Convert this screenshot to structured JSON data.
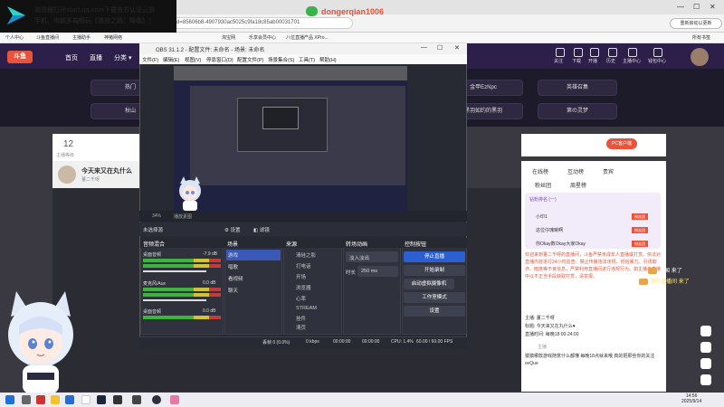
{
  "ad": {
    "line1": "浏览器打开start.qq.com下载官方认证云游",
    "line2": "手机、电脑多端畅玩《流放之路：降临》！"
  },
  "watermark": "dongerqian1006",
  "browser": {
    "url": "758&dyshid=85606b8-4907930ac5025c9fa18c85ab00031701",
    "update_label": "重新启动以更新",
    "bookmarks": [
      "个人中心",
      "斗鱼直播间",
      "主播助手",
      "神猪网络",
      "淘宝网",
      "乐享会员中心",
      "八位直播产品 XPro..."
    ],
    "all_bookmarks": "所有书签"
  },
  "site": {
    "logo": "斗鱼",
    "nav": [
      "首页",
      "直播",
      "分类 ▾"
    ],
    "nav_right": [
      "关注",
      "下载",
      "开播",
      "历史",
      "主播中心",
      "钱包中心"
    ],
    "categories_row1": [
      "热门",
      "",
      "",
      "",
      "金甲EzNpc",
      "英雄召集"
    ],
    "categories_row2": [
      "秋山",
      "",
      "",
      "",
      "黑羽如约的黑羽",
      "第の灵梦"
    ]
  },
  "room": {
    "stat_num": "12",
    "stat_label": "主播等级",
    "title": "今天来又在丸什么",
    "subtitle": "董二千呀"
  },
  "chat": {
    "pc_button": "PC客户端",
    "tabs": [
      "在线榜",
      "互动榜",
      "贵宾",
      "粉丝团",
      "周星榜"
    ],
    "rank_header": "钻粉排名 (一)",
    "ranks": [
      {
        "name": "小印1",
        "tag": "粉丝团"
      },
      {
        "name": "这位仔瑰喇啊",
        "tag": "粉丝团"
      },
      {
        "name": "你Okay数Okay大家Okay",
        "tag": "粉丝团"
      }
    ],
    "system_msg": "欢迎来到董二千呀的直播间，斗鱼严禁未成年人直播或打赏。依法对直播内容进行24小时巡查。禁止传播违法违规、低俗暴力、引诱欺诈、暗度等不良信息，严禁利用直播间进行违规行为。如主播在直播中以不正当手段获取打赏，请举报。",
    "lines": [
      {
        "user": "主播",
        "text": "董二千呀"
      },
      {
        "user": "标题",
        "text": "今天来又在丸什么♥"
      },
      {
        "user": "直播时间",
        "text": "每晚18:00-24:00"
      }
    ],
    "owner_label": "主播",
    "input_text": "猿猿哪款游戏随意什么都懂 每晚18点就来哦 真的把那些你的关注ovQue"
  },
  "floating": {
    "f1_user": "老国",
    "f1_text": "来了",
    "f2_user": "渣的直播间",
    "f2_text": "来了"
  },
  "obs": {
    "title": "OBS 31.1.2 - 配置文件: 未命名 - 场景: 未命名",
    "menu": [
      "文件(F)",
      "编辑(E)",
      "视图(V)",
      "停靠窗口(D)",
      "配置文件(P)",
      "场景集合(S)",
      "工具(T)",
      "帮助(H)"
    ],
    "zoom": "34%",
    "scale_label": "播放素图",
    "scene_name": "未选择源",
    "settings_label": "设置",
    "filters_label": "滤镜",
    "docks": {
      "mixer": "音频混合",
      "scenes": "场景",
      "sources": "来源",
      "transitions": "转场动画",
      "controls": "控制按钮"
    },
    "mixer_tracks": [
      {
        "name": "桌面音频",
        "db": "-7.9 dB"
      },
      {
        "name": "麦克风/Aux",
        "db": "0.0 dB"
      },
      {
        "name": "桌面音频",
        "db": "0.0 dB"
      }
    ],
    "scenes": [
      "游戏",
      "唱歌",
      "看视频",
      "聊天"
    ],
    "sources": [
      "清硅之影",
      "打电话",
      "开场",
      "浏览器",
      "心率",
      "STREAM",
      "挂件",
      "清页"
    ],
    "transition": {
      "type": "淡入淡出",
      "duration_label": "时长",
      "duration": "250 ms"
    },
    "controls": [
      "停止直播",
      "开始录制",
      "启动虚拟摄像机",
      "工作室模式",
      "设置"
    ],
    "status": {
      "dropped": "丢帧 0 (0.0%)",
      "kbps": "0 kbps",
      "rec": "00:00:00",
      "live": "00:00:00",
      "cpu": "CPU: 1.4%",
      "fps": "60.00 / 60.00 FPS"
    }
  },
  "taskbar": {
    "time": "14:56",
    "date": "2025/9/14"
  },
  "colors": {
    "accent": "#e8533a",
    "obs_blue": "#2c5fcf",
    "site_nav": "#2c1f4a"
  }
}
